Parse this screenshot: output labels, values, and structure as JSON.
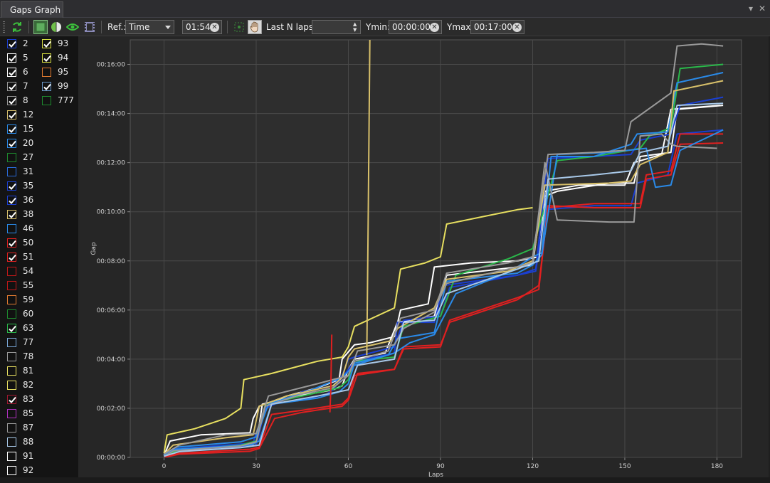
{
  "window": {
    "tab_title": "Gaps Graph",
    "tab_menu_glyph": "▾",
    "tab_close_glyph": "✕"
  },
  "toolbar": {
    "icons": [
      "refresh-icon",
      "select-all-icon",
      "color-toggle-icon",
      "visibility-icon",
      "film-icon",
      "select-region-icon",
      "pan-hand-icon"
    ],
    "ref_label": "Ref.:",
    "ref_value": "Time",
    "ref_options": [
      "Time"
    ],
    "time_value": "01:54",
    "last_n_label": "Last N laps:",
    "last_n_value": "",
    "ymin_label": "Ymin:",
    "ymin_value": "00:00:00",
    "ymax_label": "Ymax:",
    "ymax_value": "00:17:00"
  },
  "drivers": [
    {
      "num": "2",
      "color": "#1a3fd1",
      "checked": true
    },
    {
      "num": "5",
      "color": "#ffffff",
      "checked": true
    },
    {
      "num": "6",
      "color": "#ffffff",
      "checked": true
    },
    {
      "num": "7",
      "color": "#9a9a9a",
      "checked": true
    },
    {
      "num": "8",
      "color": "#9a9a9a",
      "checked": true
    },
    {
      "num": "12",
      "color": "#d8c06a",
      "checked": true
    },
    {
      "num": "15",
      "color": "#2a8ae8",
      "checked": true
    },
    {
      "num": "20",
      "color": "#2a8ae8",
      "checked": true
    },
    {
      "num": "27",
      "color": "#1e8a2e",
      "checked": false
    },
    {
      "num": "31",
      "color": "#2a6ad8",
      "checked": false
    },
    {
      "num": "35",
      "color": "#1a3fd1",
      "checked": true
    },
    {
      "num": "36",
      "color": "#1a3fd1",
      "checked": true
    },
    {
      "num": "38",
      "color": "#d8c06a",
      "checked": true
    },
    {
      "num": "46",
      "color": "#2a8ae8",
      "checked": false
    },
    {
      "num": "50",
      "color": "#e02020",
      "checked": true
    },
    {
      "num": "51",
      "color": "#e02020",
      "checked": true
    },
    {
      "num": "54",
      "color": "#c01818",
      "checked": false
    },
    {
      "num": "55",
      "color": "#c01818",
      "checked": false
    },
    {
      "num": "59",
      "color": "#e07a30",
      "checked": false
    },
    {
      "num": "60",
      "color": "#1e8a2e",
      "checked": false
    },
    {
      "num": "63",
      "color": "#2ab84a",
      "checked": true
    },
    {
      "num": "77",
      "color": "#7aa8d8",
      "checked": false
    },
    {
      "num": "78",
      "color": "#9a9a9a",
      "checked": false
    },
    {
      "num": "81",
      "color": "#e8e060",
      "checked": false
    },
    {
      "num": "82",
      "color": "#e8e060",
      "checked": false
    },
    {
      "num": "83",
      "color": "#a01830",
      "checked": true
    },
    {
      "num": "85",
      "color": "#b030c0",
      "checked": false
    },
    {
      "num": "87",
      "color": "#9a9a9a",
      "checked": false
    },
    {
      "num": "88",
      "color": "#a8c8e8",
      "checked": false
    },
    {
      "num": "91",
      "color": "#ffffff",
      "checked": false
    },
    {
      "num": "92",
      "color": "#ffffff",
      "checked": false
    },
    {
      "num": "93",
      "color": "#d8e040",
      "checked": true
    },
    {
      "num": "94",
      "color": "#d8e040",
      "checked": true
    },
    {
      "num": "95",
      "color": "#e07a30",
      "checked": false
    },
    {
      "num": "99",
      "color": "#6a98c8",
      "checked": true
    },
    {
      "num": "777",
      "color": "#1e8a2e",
      "checked": false
    }
  ],
  "chart_data": {
    "type": "line",
    "xlabel": "Laps",
    "ylabel": "Gap",
    "xlim": [
      -11,
      188
    ],
    "ylim": [
      0,
      1020
    ],
    "x_ticks": [
      0,
      30,
      60,
      90,
      120,
      150,
      180
    ],
    "y_ticks": [
      {
        "value": 0,
        "label": "00:00:00"
      },
      {
        "value": 120,
        "label": "00:02:00"
      },
      {
        "value": 240,
        "label": "00:04:00"
      },
      {
        "value": 360,
        "label": "00:06:00"
      },
      {
        "value": 480,
        "label": "00:08:00"
      },
      {
        "value": 600,
        "label": "00:10:00"
      },
      {
        "value": 720,
        "label": "00:12:00"
      },
      {
        "value": 840,
        "label": "00:14:00"
      },
      {
        "value": 960,
        "label": "00:16:00"
      }
    ],
    "grid": true,
    "series": [
      {
        "color": "#e8e060",
        "x": [
          0,
          1,
          10,
          20,
          25,
          26,
          35,
          45,
          50,
          58,
          60,
          62,
          75,
          77,
          85,
          90,
          92,
          105,
          115,
          120
        ],
        "y": [
          10,
          55,
          70,
          95,
          120,
          190,
          205,
          225,
          235,
          245,
          270,
          320,
          365,
          460,
          475,
          490,
          570,
          590,
          605,
          610
        ]
      },
      {
        "color": "#ffffff",
        "x": [
          0,
          2,
          12,
          28,
          29,
          31,
          40,
          50,
          57,
          58,
          62,
          67,
          75,
          77,
          86,
          88,
          100,
          115,
          122,
          124,
          135,
          150,
          153,
          162,
          165,
          181
        ],
        "y": [
          5,
          40,
          55,
          60,
          95,
          125,
          150,
          170,
          190,
          240,
          275,
          280,
          295,
          360,
          375,
          465,
          475,
          480,
          490,
          650,
          665,
          665,
          720,
          740,
          850,
          860
        ]
      },
      {
        "color": "#ffffff",
        "x": [
          0,
          3,
          15,
          30,
          32,
          40,
          55,
          58,
          60,
          62,
          72,
          76,
          88,
          92,
          115,
          120,
          123,
          128,
          145,
          153,
          155,
          165,
          167,
          182
        ],
        "y": [
          3,
          20,
          25,
          30,
          130,
          145,
          165,
          175,
          215,
          240,
          255,
          330,
          345,
          445,
          465,
          470,
          635,
          650,
          670,
          670,
          735,
          745,
          850,
          860
        ]
      },
      {
        "color": "#1a3fd1",
        "x": [
          0,
          3,
          20,
          29,
          30,
          34,
          45,
          53,
          55,
          58,
          62,
          75,
          76,
          88,
          91,
          115,
          121,
          124,
          140,
          152,
          154,
          164,
          167,
          182
        ],
        "y": [
          2,
          20,
          30,
          35,
          60,
          130,
          140,
          155,
          165,
          195,
          235,
          255,
          330,
          330,
          420,
          445,
          455,
          605,
          615,
          615,
          670,
          690,
          790,
          800
        ]
      },
      {
        "color": "#1a3fd1",
        "x": [
          0,
          4,
          25,
          30,
          33,
          45,
          55,
          58,
          60,
          62,
          75,
          78,
          90,
          93,
          115,
          121,
          125,
          140,
          152,
          155,
          165,
          168,
          182
        ],
        "y": [
          1,
          15,
          25,
          30,
          120,
          160,
          175,
          200,
          240,
          245,
          270,
          335,
          345,
          415,
          445,
          460,
          730,
          735,
          740,
          775,
          790,
          860,
          880
        ]
      },
      {
        "color": "#e02020",
        "x": [
          0,
          5,
          28,
          31,
          35,
          45,
          58,
          60,
          62,
          75,
          78,
          90,
          93,
          115,
          122,
          125,
          140,
          155,
          157,
          165,
          168,
          182
        ],
        "y": [
          0,
          10,
          20,
          25,
          105,
          115,
          130,
          145,
          200,
          215,
          270,
          275,
          330,
          385,
          420,
          610,
          620,
          620,
          690,
          700,
          790,
          790
        ]
      },
      {
        "color": "#e02020",
        "x": [
          0,
          5,
          28,
          31,
          36,
          45,
          58,
          60,
          63,
          75,
          78,
          90,
          93,
          115,
          122,
          125,
          140,
          155,
          157,
          165,
          168,
          182
        ],
        "y": [
          0,
          8,
          15,
          22,
          95,
          110,
          125,
          140,
          205,
          215,
          265,
          270,
          335,
          390,
          410,
          615,
          610,
          610,
          680,
          690,
          765,
          768
        ]
      },
      {
        "color": "#2ab84a",
        "x": [
          0,
          5,
          25,
          30,
          33,
          45,
          57,
          60,
          62,
          75,
          78,
          90,
          95,
          112,
          120,
          125,
          128,
          140,
          155,
          158,
          165,
          168,
          182
        ],
        "y": [
          5,
          18,
          30,
          40,
          130,
          150,
          170,
          190,
          235,
          245,
          320,
          345,
          445,
          485,
          510,
          640,
          725,
          735,
          755,
          785,
          805,
          950,
          960
        ]
      },
      {
        "color": "#2a8ae8",
        "x": [
          0,
          4,
          28,
          31,
          35,
          50,
          57,
          60,
          62,
          73,
          76,
          88,
          92,
          115,
          120,
          123,
          128,
          145,
          157,
          160,
          165,
          168,
          182
        ],
        "y": [
          5,
          20,
          30,
          40,
          130,
          145,
          160,
          180,
          230,
          250,
          290,
          305,
          430,
          450,
          470,
          495,
          740,
          745,
          755,
          660,
          665,
          750,
          800
        ]
      },
      {
        "color": "#2a8ae8",
        "x": [
          0,
          4,
          25,
          30,
          34,
          48,
          58,
          60,
          62,
          75,
          80,
          88,
          95,
          113,
          120,
          123,
          126,
          140,
          152,
          154,
          164,
          167,
          182
        ],
        "y": [
          6,
          25,
          38,
          50,
          130,
          165,
          195,
          210,
          225,
          255,
          280,
          300,
          400,
          455,
          490,
          500,
          735,
          735,
          765,
          790,
          795,
          915,
          940
        ]
      },
      {
        "color": "#d8c06a",
        "x": [
          0,
          3,
          20,
          29,
          31,
          40,
          55,
          58,
          60,
          62,
          74,
          76,
          88,
          92,
          112,
          120,
          124,
          145,
          152,
          155,
          164,
          166,
          182
        ],
        "y": [
          8,
          30,
          48,
          55,
          125,
          150,
          175,
          195,
          245,
          265,
          285,
          315,
          365,
          435,
          455,
          480,
          665,
          670,
          675,
          715,
          745,
          895,
          920
        ]
      },
      {
        "color": "#9a9a9a",
        "x": [
          0,
          3,
          25,
          30,
          33,
          45,
          55,
          60,
          62,
          73,
          77,
          88,
          92,
          112,
          120,
          124,
          128,
          145,
          153,
          155,
          162,
          165,
          167,
          180
        ],
        "y": [
          2,
          16,
          28,
          38,
          125,
          155,
          170,
          200,
          235,
          260,
          340,
          360,
          425,
          460,
          475,
          720,
          580,
          575,
          575,
          785,
          790,
          765,
          760,
          755
        ]
      },
      {
        "color": "#9a9a9a",
        "x": [
          0,
          5,
          20,
          30,
          34,
          50,
          60,
          63,
          75,
          78,
          88,
          92,
          112,
          120,
          125,
          140,
          150,
          152,
          165,
          167,
          175,
          182
        ],
        "y": [
          8,
          30,
          55,
          58,
          150,
          180,
          200,
          260,
          275,
          315,
          355,
          450,
          475,
          490,
          740,
          745,
          750,
          820,
          890,
          1005,
          1010,
          1005
        ]
      },
      {
        "color": "#a8c8e8",
        "x": [
          0,
          5,
          25,
          31,
          35,
          50,
          60,
          63,
          75,
          78,
          88,
          92,
          115,
          122,
          125,
          140,
          152,
          155,
          164,
          167,
          182
        ],
        "y": [
          3,
          14,
          24,
          30,
          130,
          150,
          165,
          225,
          240,
          330,
          335,
          400,
          460,
          480,
          680,
          690,
          700,
          745,
          760,
          860,
          865
        ]
      },
      {
        "color": "#d8c06a",
        "x": [
          66,
          66.5,
          67
        ],
        "y": [
          250,
          600,
          1020
        ]
      },
      {
        "color": "#e02020",
        "x": [
          54,
          54.3,
          54.6
        ],
        "y": [
          110,
          170,
          300
        ]
      }
    ]
  }
}
